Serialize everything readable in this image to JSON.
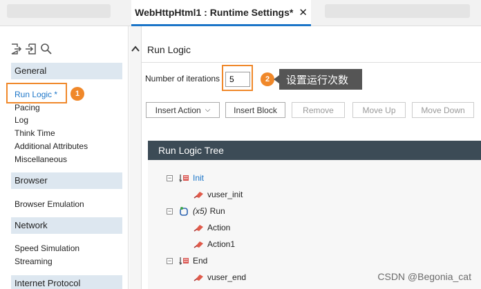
{
  "tab": {
    "title": "WebHttpHtml1 : Runtime Settings*",
    "close": "✕"
  },
  "sidebar": {
    "sections": [
      {
        "label": "General"
      },
      {
        "label": "Browser"
      },
      {
        "label": "Network"
      },
      {
        "label": "Internet Protocol"
      }
    ],
    "general_items": [
      "Run Logic *",
      "Pacing",
      "Log",
      "Think Time",
      "Additional Attributes",
      "Miscellaneous"
    ],
    "browser_items": [
      "Browser Emulation"
    ],
    "network_items": [
      "Speed Simulation",
      "Streaming"
    ],
    "badge": "1"
  },
  "main": {
    "title": "Run Logic",
    "iterations_label": "Number of iterations",
    "iterations_value": "5",
    "badge": "2",
    "tooltip": "设置运行次数",
    "buttons": {
      "insert_action": "Insert Action",
      "insert_block": "Insert Block",
      "remove": "Remove",
      "move_up": "Move Up",
      "move_down": "Move Down"
    },
    "tree": {
      "header": "Run Logic Tree",
      "init": "Init",
      "vuser_init": "vuser_init",
      "run_iter": "(x5)",
      "run": "Run",
      "action": "Action",
      "action1": "Action1",
      "end": "End",
      "vuser_end": "vuser_end"
    }
  },
  "watermark": "CSDN @Begonia_cat",
  "colors": {
    "accent": "#1b75c8",
    "highlight": "#f0882a",
    "tree_header": "#3c4b56",
    "section_bg": "#dde7f0"
  }
}
